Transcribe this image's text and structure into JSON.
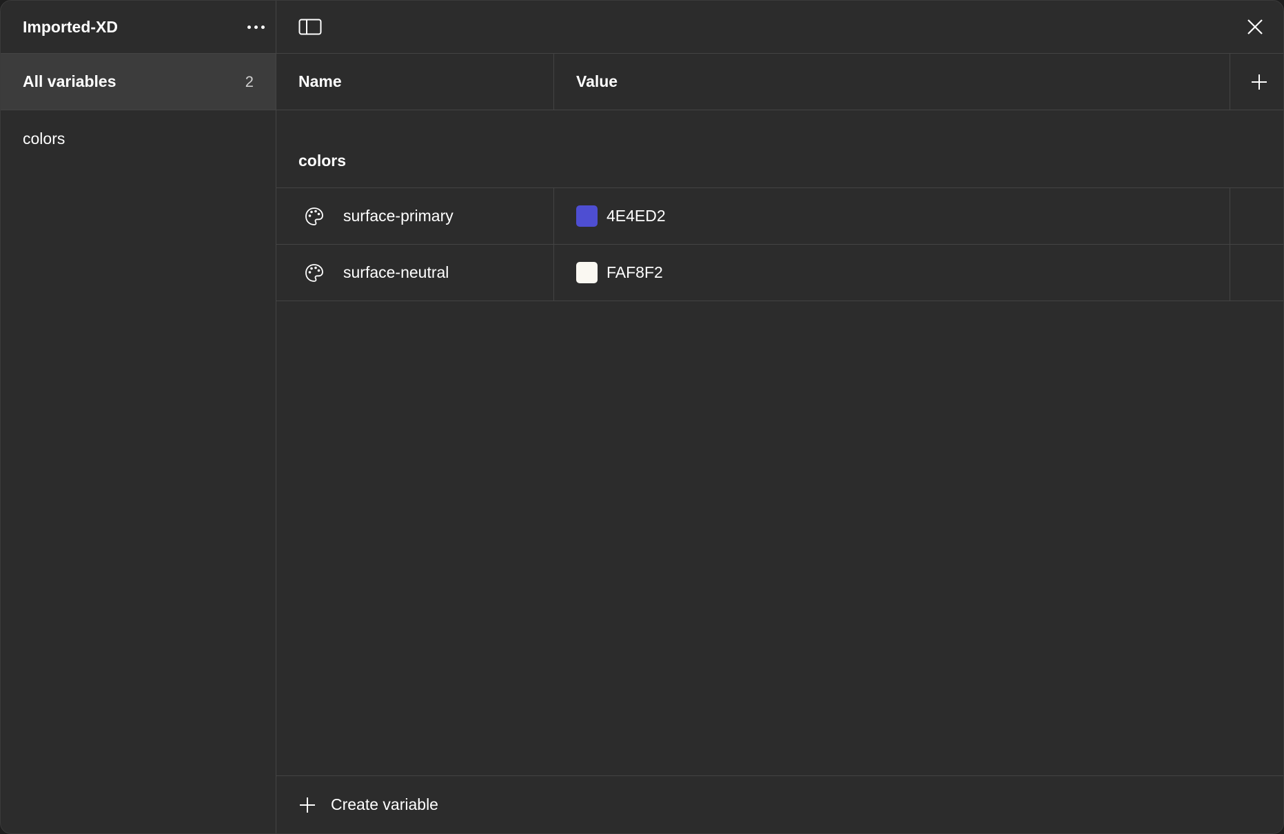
{
  "sidebar": {
    "title": "Imported-XD",
    "items": [
      {
        "label": "All variables",
        "count": "2"
      },
      {
        "label": "colors"
      }
    ]
  },
  "table": {
    "headers": {
      "name": "Name",
      "value": "Value"
    }
  },
  "group": {
    "title": "colors",
    "rows": [
      {
        "name": "surface-primary",
        "value": "4E4ED2",
        "color": "#4E4ED2"
      },
      {
        "name": "surface-neutral",
        "value": "FAF8F2",
        "color": "#FAF8F2"
      }
    ]
  },
  "footer": {
    "create_label": "Create variable"
  },
  "icons": [
    "more-icon",
    "panel-toggle-icon",
    "close-icon",
    "plus-icon",
    "palette-icon"
  ]
}
